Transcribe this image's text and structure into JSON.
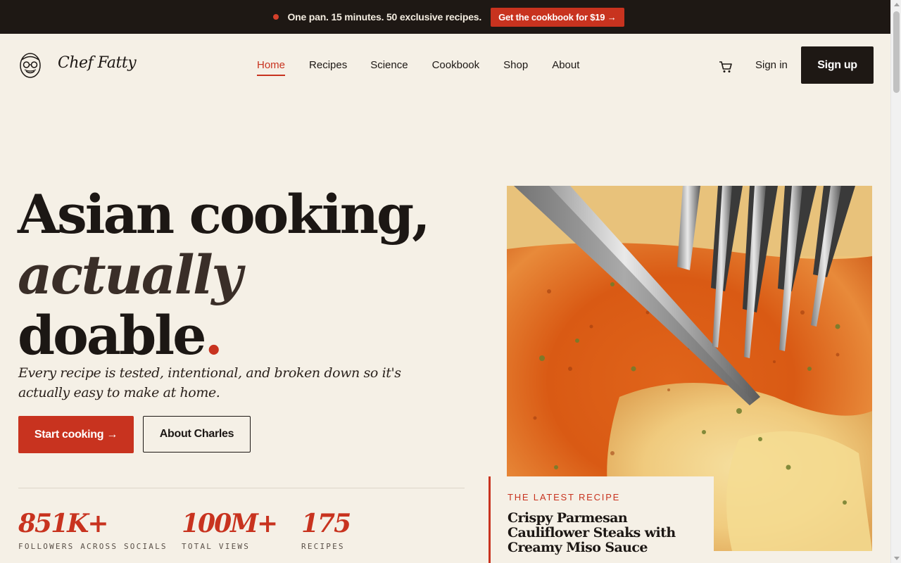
{
  "announcement": {
    "message": "One pan. 15 minutes. 50 exclusive recipes.",
    "cta": "Get the cookbook for $19 →"
  },
  "header": {
    "logo_text": "Chef Fatty",
    "nav": [
      {
        "label": "Home",
        "active": true
      },
      {
        "label": "Recipes",
        "active": false
      },
      {
        "label": "Science",
        "active": false
      },
      {
        "label": "Cookbook",
        "active": false
      },
      {
        "label": "Shop",
        "active": false
      },
      {
        "label": "About",
        "active": false
      }
    ],
    "cart_icon": "cart-icon",
    "sign_in": "Sign in",
    "sign_up": "Sign up"
  },
  "hero": {
    "line1": "Asian cooking,",
    "line2": "actually",
    "line3": "doable",
    "period": ".",
    "subtitle": "Every recipe is tested, intentional, and broken down so it's actually easy to make at home.",
    "primary_button": "Start cooking →",
    "secondary_button": "About Charles"
  },
  "stats": [
    {
      "value": "851K+",
      "label": "FOLLOWERS ACROSS SOCIALS"
    },
    {
      "value": "100M+",
      "label": "TOTAL VIEWS"
    },
    {
      "value": "175",
      "label": "RECIPES"
    }
  ],
  "latest_recipe": {
    "kicker": "THE LATEST RECIPE",
    "title": "Crispy Parmesan Cauliflower Steaks with Creamy Miso Sauce"
  },
  "colors": {
    "accent": "#c8331f",
    "background": "#f5f0e6",
    "dark": "#1e1814"
  }
}
